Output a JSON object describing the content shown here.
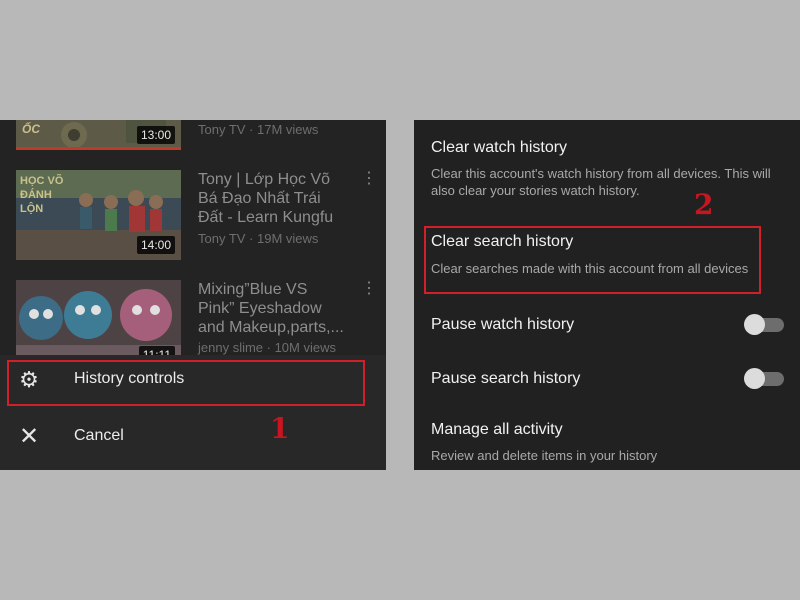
{
  "left": {
    "videos": [
      {
        "duration": "13:00",
        "title": "",
        "meta": "Tony TV · 17M views",
        "thumb_text": "ỐC"
      },
      {
        "duration": "14:00",
        "title": "Tony | Lớp Học Võ Bá Đạo Nhất Trái Đất - Learn Kungfu",
        "meta": "Tony TV · 19M views",
        "thumb_text": "HỌC VÕ ĐÁNH LỘN"
      },
      {
        "duration": "11:11",
        "title": "Mixing”Blue VS Pink” Eyeshadow and Makeup,parts,...",
        "meta": "jenny slime · 10M views"
      }
    ],
    "sheet": {
      "history_controls": "History controls",
      "cancel": "Cancel"
    },
    "annotation_number": "1"
  },
  "right": {
    "clear_watch": {
      "title": "Clear watch history",
      "desc": "Clear this account's watch history from all devices. This will also clear your stories watch history."
    },
    "clear_search": {
      "title": "Clear search history",
      "desc": "Clear searches made with this account from all devices"
    },
    "pause_watch": {
      "title": "Pause watch history",
      "on": false
    },
    "pause_search": {
      "title": "Pause search history",
      "on": false
    },
    "manage_activity": {
      "title": "Manage all activity",
      "desc": "Review and delete items in your history"
    },
    "annotation_number": "2"
  },
  "colors": {
    "background": "#b8b8b8",
    "panel": "#212121",
    "highlight_box": "#d1202a",
    "annotation_number": "#c8151f"
  },
  "icons": [
    "gear-icon",
    "close-icon",
    "more-vert-icon"
  ]
}
